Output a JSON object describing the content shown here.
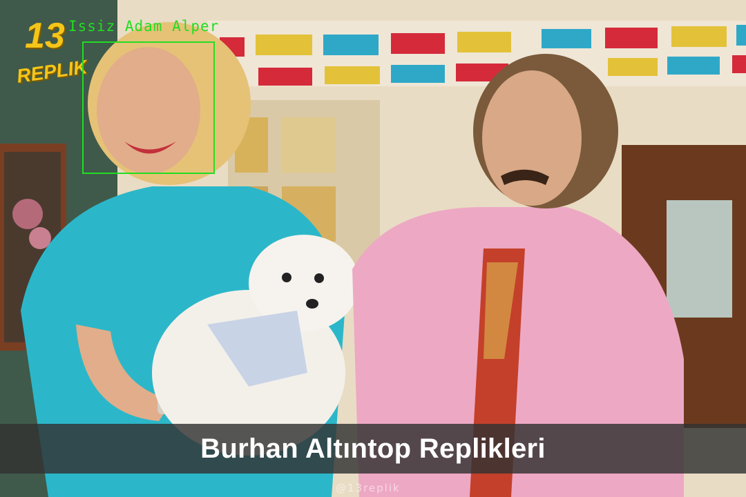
{
  "logo": {
    "number": "13",
    "word": "REPLIK",
    "color": "#f5c518"
  },
  "detection": {
    "label": "Issiz Adam Alper",
    "color": "#22dd22"
  },
  "caption": {
    "title": "Burhan Altıntop Replikleri"
  },
  "watermark": "@13replik"
}
